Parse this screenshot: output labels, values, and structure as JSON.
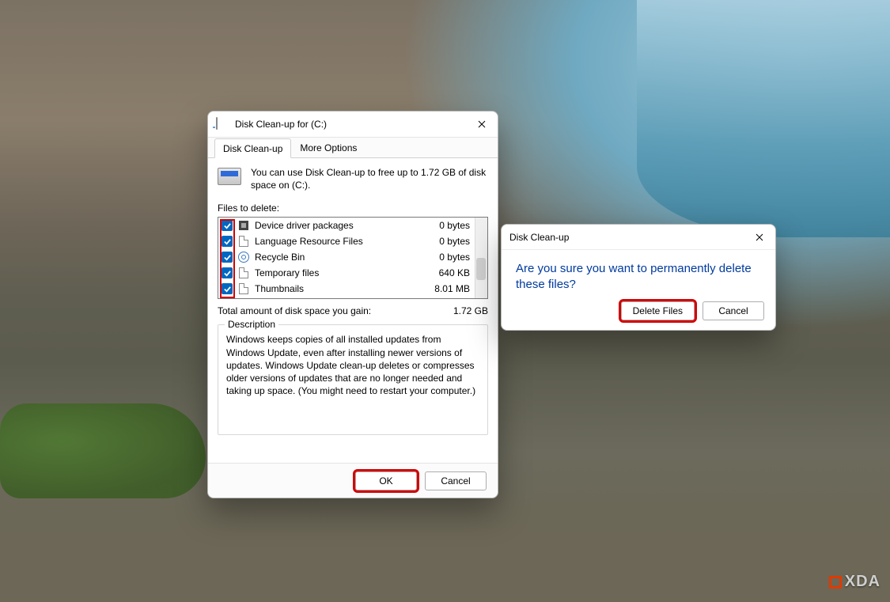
{
  "cleanup": {
    "title": "Disk Clean-up for  (C:)",
    "tabs": {
      "cleanup": "Disk Clean-up",
      "more": "More Options"
    },
    "intro": "You can use Disk Clean-up to free up to 1.72 GB of disk space on  (C:).",
    "list_label": "Files to delete:",
    "items": [
      {
        "name": "Device driver packages",
        "size": "0 bytes",
        "checked": true,
        "icon": "chip"
      },
      {
        "name": "Language Resource Files",
        "size": "0 bytes",
        "checked": true,
        "icon": "file"
      },
      {
        "name": "Recycle Bin",
        "size": "0 bytes",
        "checked": true,
        "icon": "recycle"
      },
      {
        "name": "Temporary files",
        "size": "640 KB",
        "checked": true,
        "icon": "file"
      },
      {
        "name": "Thumbnails",
        "size": "8.01 MB",
        "checked": true,
        "icon": "file"
      }
    ],
    "total_label": "Total amount of disk space you gain:",
    "total_value": "1.72 GB",
    "group_title": "Description",
    "description": "Windows keeps copies of all installed updates from Windows Update, even after installing newer versions of updates. Windows Update clean-up deletes or compresses older versions of updates that are no longer needed and taking up space. (You might need to restart your computer.)",
    "ok": "OK",
    "cancel": "Cancel"
  },
  "confirm": {
    "title": "Disk Clean-up",
    "message": "Are you sure you want to permanently delete these files?",
    "delete": "Delete Files",
    "cancel": "Cancel"
  },
  "watermark": "XDA"
}
